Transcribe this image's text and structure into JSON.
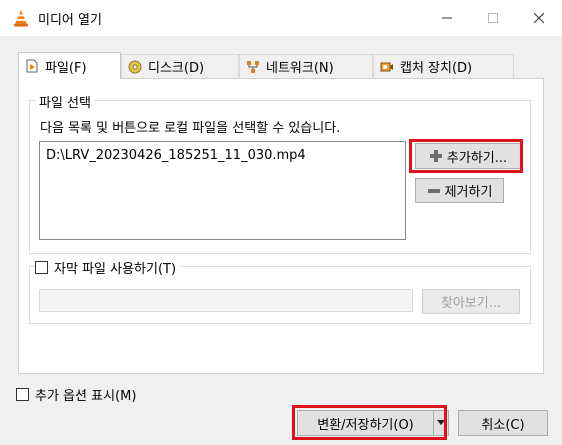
{
  "window": {
    "title": "미디어 열기"
  },
  "tabs": [
    {
      "label": "파일(F)",
      "icon": "file-icon",
      "active": true
    },
    {
      "label": "디스크(D)",
      "icon": "disc-icon",
      "active": false
    },
    {
      "label": "네트워크(N)",
      "icon": "network-icon",
      "active": false
    },
    {
      "label": "캡처 장치(D)",
      "icon": "capture-device-icon",
      "active": false
    }
  ],
  "file_selection": {
    "group_title": "파일 선택",
    "description": "다음 목록 및 버튼으로 로컬 파일을 선택할 수 있습니다.",
    "files": [
      "D:\\LRV_20230426_185251_11_030.mp4"
    ],
    "add_label": "추가하기...",
    "remove_label": "제거하기"
  },
  "subtitle": {
    "checkbox_label": "자막 파일 사용하기(T)",
    "checked": false,
    "browse_label": "찾아보기...",
    "path_value": ""
  },
  "options": {
    "show_more_label": "추가 옵션 표시(M)",
    "checked": false
  },
  "footer": {
    "convert_label": "변환/저장하기(O)",
    "cancel_label": "취소(C)"
  },
  "colors": {
    "highlight": "#e0101c",
    "window_bg": "#f0f0f0",
    "vlc_orange": "#f08010"
  }
}
